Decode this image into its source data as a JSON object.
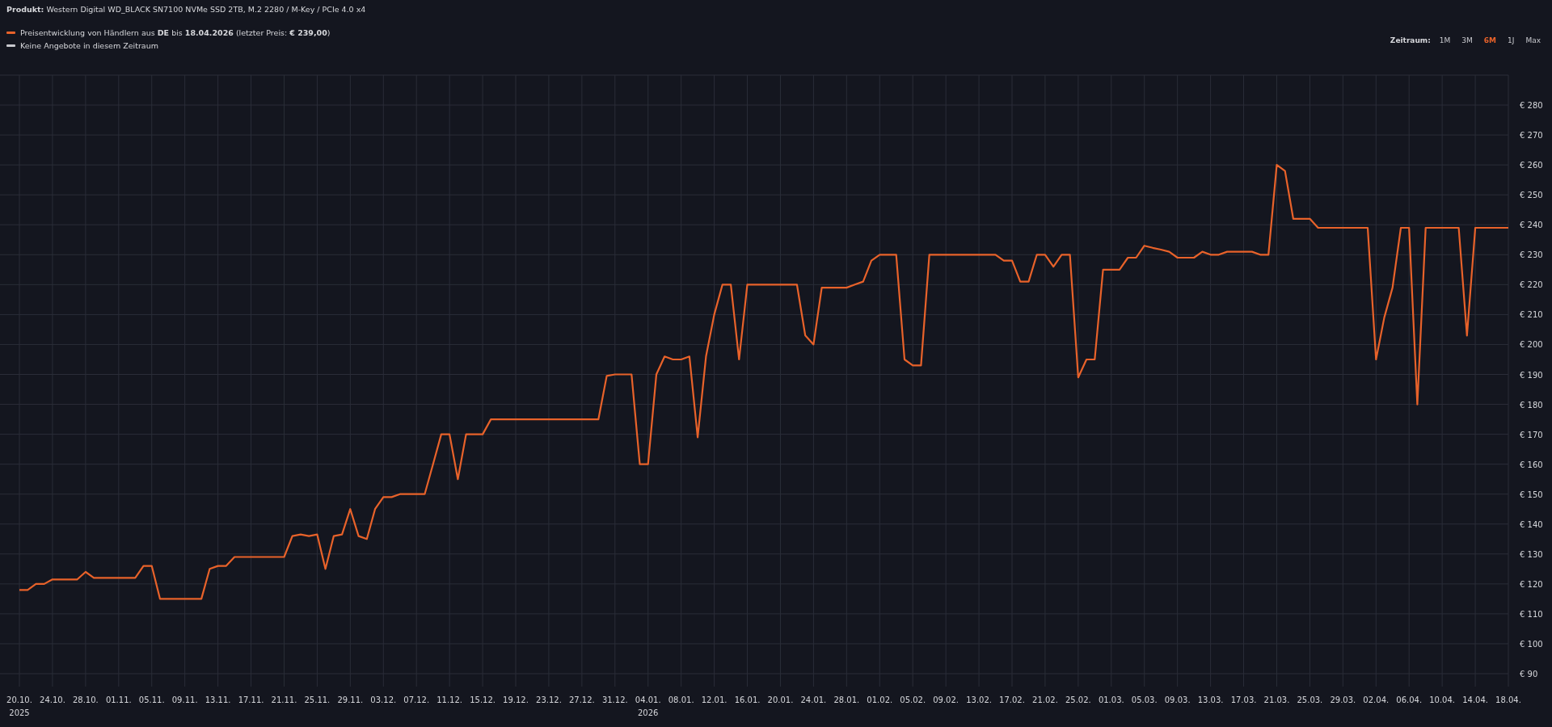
{
  "product": "**Produkt:** Western Digital WD_BLACK SN7100 NVMe SSD 2TB, M.2 2280 / M-Key / PCIe 4.0 x4",
  "legend": {
    "items": [
      {
        "text": "Preisentwicklung von Händlern aus **DE** bis **18.04.2026** (letzter Preis: **€ 239,00**)",
        "color": "#e8622a"
      },
      {
        "text": "Keine Angebote in diesem Zeitraum",
        "color": "#c8c9ce"
      }
    ]
  },
  "timeframe": {
    "label": "Zeitraum:",
    "options": [
      {
        "label": "1M",
        "selected": false
      },
      {
        "label": "3M",
        "selected": false
      },
      {
        "label": "6M",
        "selected": true
      },
      {
        "label": "1J",
        "selected": false
      },
      {
        "label": "Max",
        "selected": false
      }
    ]
  },
  "chart_data": {
    "type": "line",
    "categories": [
      "20.10.",
      null,
      null,
      null,
      "24.10.",
      null,
      null,
      null,
      "28.10.",
      null,
      null,
      null,
      "01.11.",
      null,
      null,
      null,
      "05.11.",
      null,
      null,
      null,
      "09.11.",
      null,
      null,
      null,
      "13.11.",
      null,
      null,
      null,
      "17.11.",
      null,
      null,
      null,
      "21.11.",
      null,
      null,
      null,
      "25.11.",
      null,
      null,
      null,
      "29.11.",
      null,
      null,
      null,
      "03.12.",
      null,
      null,
      null,
      "07.12.",
      null,
      null,
      null,
      "11.12.",
      null,
      null,
      null,
      "15.12.",
      null,
      null,
      null,
      "19.12.",
      null,
      null,
      null,
      "23.12.",
      null,
      null,
      null,
      "27.12.",
      null,
      null,
      null,
      "31.12.",
      null,
      null,
      null,
      "04.01.",
      null,
      null,
      null,
      "08.01.",
      null,
      null,
      null,
      "12.01.",
      null,
      null,
      null,
      "16.01.",
      null,
      null,
      null,
      "20.01.",
      null,
      null,
      null,
      "24.01.",
      null,
      null,
      null,
      "28.01.",
      null,
      null,
      null,
      "01.02.",
      null,
      null,
      null,
      "05.02.",
      null,
      null,
      null,
      "09.02.",
      null,
      null,
      null,
      "13.02.",
      null,
      null,
      null,
      "17.02.",
      null,
      null,
      null,
      "21.02.",
      null,
      null,
      null,
      "25.02.",
      null,
      null,
      null,
      "01.03.",
      null,
      null,
      null,
      "05.03.",
      null,
      null,
      null,
      "09.03.",
      null,
      null,
      null,
      "13.03.",
      null,
      null,
      null,
      "17.03.",
      null,
      null,
      null,
      "21.03.",
      null,
      null,
      null,
      "25.03.",
      null,
      null,
      null,
      "29.03.",
      null,
      null,
      null,
      "02.04.",
      null,
      null,
      null,
      "06.04.",
      null,
      null,
      null,
      "10.04.",
      null,
      null,
      null,
      "14.04.",
      null,
      null,
      null,
      "18.04."
    ],
    "series": [
      {
        "color": "#e8622a",
        "values": [
          118,
          118,
          120,
          120,
          121.5,
          121.5,
          121.5,
          121.5,
          124,
          122,
          122,
          122,
          122,
          122,
          122,
          126,
          126,
          115,
          115,
          115,
          115,
          115,
          115,
          125,
          126,
          126,
          129,
          129,
          129,
          129,
          129,
          129,
          129,
          136,
          136.5,
          136,
          136.5,
          125,
          136,
          136.5,
          145,
          136,
          135,
          145,
          149,
          149,
          150,
          150,
          150,
          150,
          160,
          170,
          170,
          155,
          170,
          170,
          170,
          175,
          175,
          175,
          175,
          175,
          175,
          175,
          175,
          175,
          175,
          175,
          175,
          175,
          175,
          189.5,
          190,
          190,
          190,
          160,
          160,
          190,
          196,
          195,
          195,
          196,
          169,
          196,
          210,
          220,
          220,
          195,
          220,
          220,
          220,
          220,
          220,
          220,
          220,
          203,
          200,
          219,
          219,
          219,
          219,
          220,
          221,
          228,
          230,
          230,
          230,
          195,
          193,
          193,
          230,
          230,
          230,
          230,
          230,
          230,
          230,
          230,
          230,
          228,
          228,
          221,
          221,
          230,
          230,
          226,
          230,
          230,
          189,
          195,
          195,
          225,
          225,
          225,
          229,
          229,
          233,
          232.3,
          231.7,
          231,
          229,
          229,
          229,
          231,
          230,
          230,
          231,
          231,
          231,
          231,
          230,
          230,
          260,
          258,
          242,
          242,
          242,
          239,
          239,
          239,
          239,
          239,
          239,
          239,
          195,
          209,
          219,
          239,
          239,
          180,
          239,
          239,
          239,
          239,
          239,
          203,
          239,
          239,
          239,
          239,
          239
        ]
      }
    ],
    "ylim": [
      90,
      290
    ],
    "grid": true,
    "yticks": [
      {
        "value": 90,
        "label": "€ 90"
      },
      {
        "value": 100,
        "label": "€ 100"
      },
      {
        "value": 110,
        "label": "€ 110"
      },
      {
        "value": 120,
        "label": "€ 120"
      },
      {
        "value": 130,
        "label": "€ 130"
      },
      {
        "value": 140,
        "label": "€ 140"
      },
      {
        "value": 150,
        "label": "€ 150"
      },
      {
        "value": 160,
        "label": "€ 160"
      },
      {
        "value": 170,
        "label": "€ 170"
      },
      {
        "value": 180,
        "label": "€ 180"
      },
      {
        "value": 190,
        "label": "€ 190"
      },
      {
        "value": 200,
        "label": "€ 200"
      },
      {
        "value": 210,
        "label": "€ 210"
      },
      {
        "value": 220,
        "label": "€ 220"
      },
      {
        "value": 230,
        "label": "€ 230"
      },
      {
        "value": 240,
        "label": "€ 240"
      },
      {
        "value": 250,
        "label": "€ 250"
      },
      {
        "value": 260,
        "label": "€ 260"
      },
      {
        "value": 270,
        "label": "€ 270"
      },
      {
        "value": 280,
        "label": "€ 280"
      }
    ]
  },
  "year_labels": [
    "2025",
    "2026"
  ]
}
